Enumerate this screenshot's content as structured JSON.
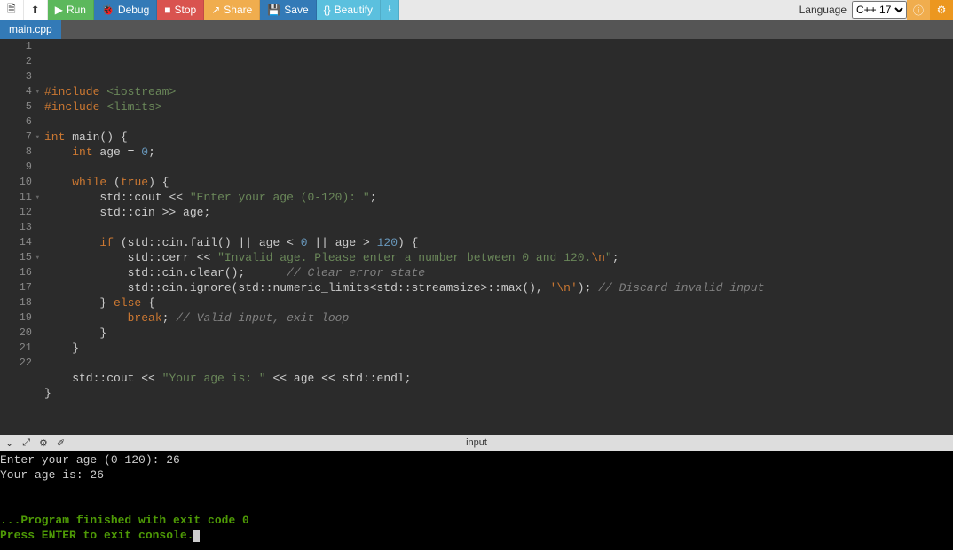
{
  "toolbar": {
    "new_icon": "📄",
    "upload_icon": "⇧",
    "run": "Run",
    "debug": "Debug",
    "stop": "Stop",
    "share": "Share",
    "save": "Save",
    "beautify": "Beautify",
    "download_icon": "⭳",
    "language_label": "Language",
    "language_value": "C++ 17",
    "info_icon": "ⓘ",
    "settings_icon": "⚙"
  },
  "tab": {
    "name": "main.cpp"
  },
  "code": {
    "lines": [
      {
        "n": 1,
        "fold": false,
        "seg": [
          [
            "t-pre",
            "#include"
          ],
          [
            "t-def",
            " "
          ],
          [
            "t-inc",
            "<iostream>"
          ]
        ]
      },
      {
        "n": 2,
        "fold": false,
        "seg": [
          [
            "t-pre",
            "#include"
          ],
          [
            "t-def",
            " "
          ],
          [
            "t-inc",
            "<limits>"
          ]
        ]
      },
      {
        "n": 3,
        "fold": false,
        "seg": []
      },
      {
        "n": 4,
        "fold": true,
        "seg": [
          [
            "t-type",
            "int"
          ],
          [
            "t-def",
            " main() {"
          ]
        ]
      },
      {
        "n": 5,
        "fold": false,
        "seg": [
          [
            "t-def",
            "    "
          ],
          [
            "t-type",
            "int"
          ],
          [
            "t-def",
            " age "
          ],
          [
            "t-op",
            "="
          ],
          [
            "t-def",
            " "
          ],
          [
            "t-num",
            "0"
          ],
          [
            "t-def",
            ";"
          ]
        ]
      },
      {
        "n": 6,
        "fold": false,
        "seg": []
      },
      {
        "n": 7,
        "fold": true,
        "seg": [
          [
            "t-def",
            "    "
          ],
          [
            "t-key",
            "while"
          ],
          [
            "t-def",
            " ("
          ],
          [
            "t-bool",
            "true"
          ],
          [
            "t-def",
            ") {"
          ]
        ]
      },
      {
        "n": 8,
        "fold": false,
        "seg": [
          [
            "t-def",
            "        std::cout "
          ],
          [
            "t-op",
            "<<"
          ],
          [
            "t-def",
            " "
          ],
          [
            "t-str",
            "\"Enter your age (0-120): \""
          ],
          [
            "t-def",
            ";"
          ]
        ]
      },
      {
        "n": 9,
        "fold": false,
        "seg": [
          [
            "t-def",
            "        std::cin "
          ],
          [
            "t-op",
            ">>"
          ],
          [
            "t-def",
            " age;"
          ]
        ]
      },
      {
        "n": 10,
        "fold": false,
        "seg": []
      },
      {
        "n": 11,
        "fold": true,
        "seg": [
          [
            "t-def",
            "        "
          ],
          [
            "t-key",
            "if"
          ],
          [
            "t-def",
            " (std::cin.fail() "
          ],
          [
            "t-op",
            "||"
          ],
          [
            "t-def",
            " age "
          ],
          [
            "t-op",
            "<"
          ],
          [
            "t-def",
            " "
          ],
          [
            "t-num",
            "0"
          ],
          [
            "t-def",
            " "
          ],
          [
            "t-op",
            "||"
          ],
          [
            "t-def",
            " age "
          ],
          [
            "t-op",
            ">"
          ],
          [
            "t-def",
            " "
          ],
          [
            "t-num",
            "120"
          ],
          [
            "t-def",
            ") {"
          ]
        ]
      },
      {
        "n": 12,
        "fold": false,
        "seg": [
          [
            "t-def",
            "            std::cerr "
          ],
          [
            "t-op",
            "<<"
          ],
          [
            "t-def",
            " "
          ],
          [
            "t-str",
            "\"Invalid age. Please enter a number between 0 and 120."
          ],
          [
            "t-esc",
            "\\n"
          ],
          [
            "t-str",
            "\""
          ],
          [
            "t-def",
            ";"
          ]
        ]
      },
      {
        "n": 13,
        "fold": false,
        "seg": [
          [
            "t-def",
            "            std::cin.clear();      "
          ],
          [
            "t-cmt",
            "// Clear error state"
          ]
        ]
      },
      {
        "n": 14,
        "fold": false,
        "seg": [
          [
            "t-def",
            "            std::cin.ignore(std::numeric_limits"
          ],
          [
            "t-lt",
            "<"
          ],
          [
            "t-def",
            "std::streamsize"
          ],
          [
            "t-lt",
            ">"
          ],
          [
            "t-def",
            "::max(), "
          ],
          [
            "t-char",
            "'\\n'"
          ],
          [
            "t-def",
            "); "
          ],
          [
            "t-cmt",
            "// Discard invalid input"
          ]
        ]
      },
      {
        "n": 15,
        "fold": true,
        "seg": [
          [
            "t-def",
            "        } "
          ],
          [
            "t-key",
            "else"
          ],
          [
            "t-def",
            " {"
          ]
        ]
      },
      {
        "n": 16,
        "fold": false,
        "seg": [
          [
            "t-def",
            "            "
          ],
          [
            "t-key",
            "break"
          ],
          [
            "t-def",
            "; "
          ],
          [
            "t-cmt",
            "// Valid input, exit loop"
          ]
        ]
      },
      {
        "n": 17,
        "fold": false,
        "seg": [
          [
            "t-def",
            "        }"
          ]
        ]
      },
      {
        "n": 18,
        "fold": false,
        "seg": [
          [
            "t-def",
            "    }"
          ]
        ]
      },
      {
        "n": 19,
        "fold": false,
        "seg": []
      },
      {
        "n": 20,
        "fold": false,
        "seg": [
          [
            "t-def",
            "    std::cout "
          ],
          [
            "t-op",
            "<<"
          ],
          [
            "t-def",
            " "
          ],
          [
            "t-str",
            "\"Your age is: \""
          ],
          [
            "t-def",
            " "
          ],
          [
            "t-op",
            "<<"
          ],
          [
            "t-def",
            " age "
          ],
          [
            "t-op",
            "<<"
          ],
          [
            "t-def",
            " std::endl;"
          ]
        ]
      },
      {
        "n": 21,
        "fold": false,
        "seg": [
          [
            "t-def",
            "}"
          ]
        ]
      },
      {
        "n": 22,
        "fold": false,
        "seg": []
      }
    ]
  },
  "panel": {
    "title": "input",
    "chevron": "⌄",
    "expand": "⤢",
    "gear": "⚙",
    "eraser": "✐"
  },
  "console": {
    "line1": "Enter your age (0-120): 26",
    "line2": "Your age is: 26",
    "blank": "",
    "exit": "...Program finished with exit code 0",
    "prompt": "Press ENTER to exit console."
  }
}
